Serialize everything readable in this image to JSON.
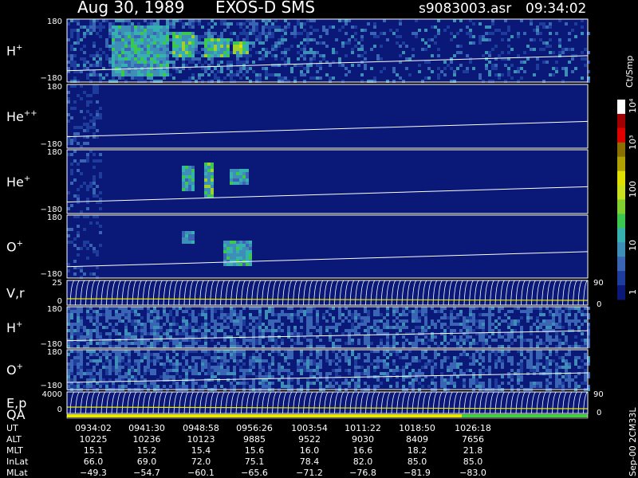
{
  "header": {
    "date": "Aug 30, 1989",
    "instrument": "EXOS-D SMS",
    "file": "s9083003.asr",
    "time": "09:34:02"
  },
  "chart_data": {
    "type": "heatmap",
    "panels": [
      {
        "id": "h-plus",
        "label": "H",
        "sup": "+",
        "ticks": [
          "180",
          "−180"
        ]
      },
      {
        "id": "he-plus-plus",
        "label": "He",
        "sup": "++",
        "ticks": [
          "180",
          "−180"
        ]
      },
      {
        "id": "he-plus",
        "label": "He",
        "sup": "+",
        "ticks": [
          "180",
          "−180"
        ]
      },
      {
        "id": "o-plus",
        "label": "O",
        "sup": "+",
        "ticks": [
          "180",
          "−180"
        ]
      },
      {
        "id": "vr",
        "label": "V,r",
        "sup": "",
        "ticks": [
          "25",
          "0"
        ],
        "right_ticks": [
          "90",
          "0"
        ]
      },
      {
        "id": "h-plus-2",
        "label": "H",
        "sup": "+",
        "ticks": [
          "180",
          "−180"
        ]
      },
      {
        "id": "o-plus-2",
        "label": "O",
        "sup": "+",
        "ticks": [
          "180",
          "−180"
        ]
      },
      {
        "id": "ep",
        "label": "E,p",
        "sup": "",
        "ticks": [
          "4000",
          "0"
        ],
        "right_ticks": [
          "90",
          "0"
        ]
      }
    ],
    "qa_label": "QA",
    "colorbar": {
      "title": "Ct/Smp",
      "labels": [
        "1",
        "10",
        "100",
        "10³",
        "10⁴"
      ]
    },
    "footer_note": "Sep-00 2CM33L",
    "ephemeris": {
      "rows": [
        {
          "name": "UT",
          "values": [
            "0934:02",
            "0941:30",
            "0948:58",
            "0956:26",
            "1003:54",
            "1011:22",
            "1018:50",
            "1026:18"
          ]
        },
        {
          "name": "ALT",
          "values": [
            "10225",
            "10236",
            "10123",
            "9885",
            "9522",
            "9030",
            "8409",
            "7656"
          ]
        },
        {
          "name": "MLT",
          "values": [
            "15.1",
            "15.2",
            "15.4",
            "15.6",
            "16.0",
            "16.6",
            "18.2",
            "21.8"
          ]
        },
        {
          "name": "InLat",
          "values": [
            "66.0",
            "69.0",
            "72.0",
            "75.1",
            "78.4",
            "82.0",
            "85.0",
            "85.0"
          ]
        },
        {
          "name": "MLat",
          "values": [
            "−49.3",
            "−54.7",
            "−60.1",
            "−65.6",
            "−71.2",
            "−76.8",
            "−81.9",
            "−83.0"
          ]
        }
      ]
    }
  }
}
